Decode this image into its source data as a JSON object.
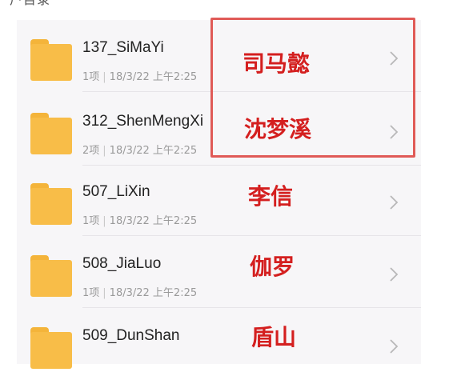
{
  "header_partial": "户目录",
  "folders": [
    {
      "name": "137_SiMaYi",
      "count": "1项",
      "date": "18/3/22 上午2:25",
      "annotation": "司马懿"
    },
    {
      "name": "312_ShenMengXi",
      "count": "2项",
      "date": "18/3/22 上午2:25",
      "annotation": "沈梦溪"
    },
    {
      "name": "507_LiXin",
      "count": "1项",
      "date": "18/3/22 上午2:25",
      "annotation": "李信"
    },
    {
      "name": "508_JiaLuo",
      "count": "1项",
      "date": "18/3/22 上午2:25",
      "annotation": "伽罗"
    },
    {
      "name": "509_DunShan",
      "count": "",
      "date": "",
      "annotation": "盾山"
    }
  ],
  "icons": {
    "folder": "folder-icon",
    "chevron": "chevron-right-icon"
  },
  "colors": {
    "annotation_text": "#d41f1f",
    "highlight_border": "#e05a57",
    "folder": "#f8bd48"
  }
}
